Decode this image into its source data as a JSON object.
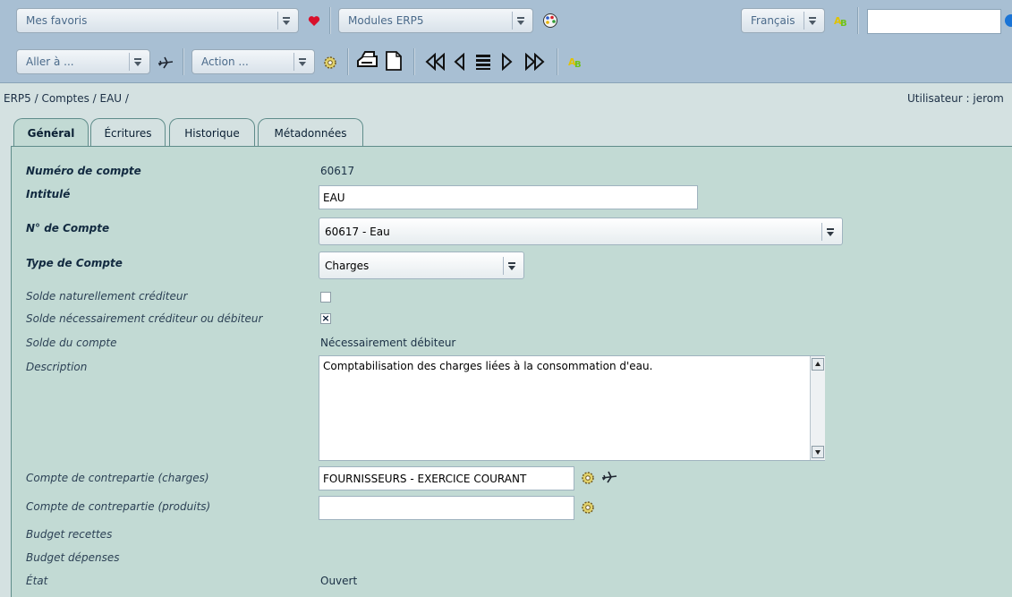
{
  "toolbar": {
    "favorites": "Mes favoris",
    "modules": "Modules ERP5",
    "language": "Français",
    "goto": "Aller à ...",
    "action": "Action ...",
    "search_value": ""
  },
  "breadcrumb": "ERP5 / Comptes / EAU /",
  "user_info": "Utilisateur : jerom",
  "tabs": [
    "Général",
    "Écritures",
    "Historique",
    "Métadonnées"
  ],
  "form": {
    "labels": {
      "account_number": "Numéro de compte",
      "title": "Intitulé",
      "gap": "N° de Compte",
      "account_type": "Type de Compte",
      "credit_balance": "Solde naturellement créditeur",
      "strict_balance": "Solde nécessairement créditeur ou débiteur",
      "balance": "Solde du compte",
      "description": "Description",
      "counterpart_charges": "Compte de contrepartie (charges)",
      "counterpart_products": "Compte de contrepartie (produits)",
      "budget_income": "Budget recettes",
      "budget_expense": "Budget dépenses",
      "state": "État"
    },
    "values": {
      "account_number": "60617",
      "title": "EAU",
      "gap": "60617 - Eau",
      "account_type": "Charges",
      "credit_balance_checked": false,
      "strict_balance_checked": true,
      "strict_balance_mark": "×",
      "balance": "Nécessairement débiteur",
      "description": "Comptabilisation des charges liées à la consommation d'eau.",
      "counterpart_charges": "FOURNISSEURS - EXERCICE COURANT",
      "counterpart_products": "",
      "state": "Ouvert"
    }
  },
  "colors": {
    "toolbar": "#a8bfd3",
    "background": "#d4e1e1",
    "panel": "#c2dad4",
    "tab_border": "#5f8c8a"
  }
}
